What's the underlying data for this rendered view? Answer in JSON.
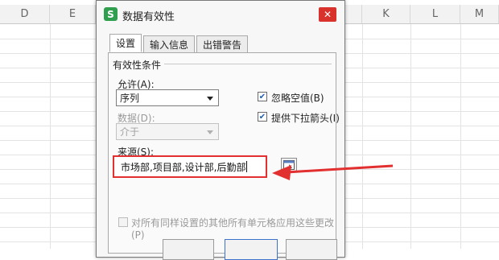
{
  "spreadsheet": {
    "columns": [
      "D",
      "E",
      "K",
      "L",
      "M"
    ]
  },
  "dialog": {
    "app_icon": "S",
    "title": "数据有效性",
    "close_icon": "✕",
    "tabs": [
      "设置",
      "输入信息",
      "出错警告"
    ],
    "section_title": "有效性条件",
    "allow_label": "允许(A):",
    "allow_value": "序列",
    "ignore_blank_label": "忽略空值(B)",
    "ignore_blank_checked": true,
    "dropdown_label": "提供下拉箭头(I)",
    "dropdown_checked": true,
    "data_label": "数据(D):",
    "data_value": "介于",
    "source_label": "来源(S):",
    "source_value": "市场部,项目部,设计部,后勤部",
    "apply_all_label": "对所有同样设置的其他所有单元格应用这些更改(P)",
    "apply_all_checked": false
  },
  "annotation": {
    "highlight_color": "#e23030",
    "arrow_color": "#e23030"
  }
}
